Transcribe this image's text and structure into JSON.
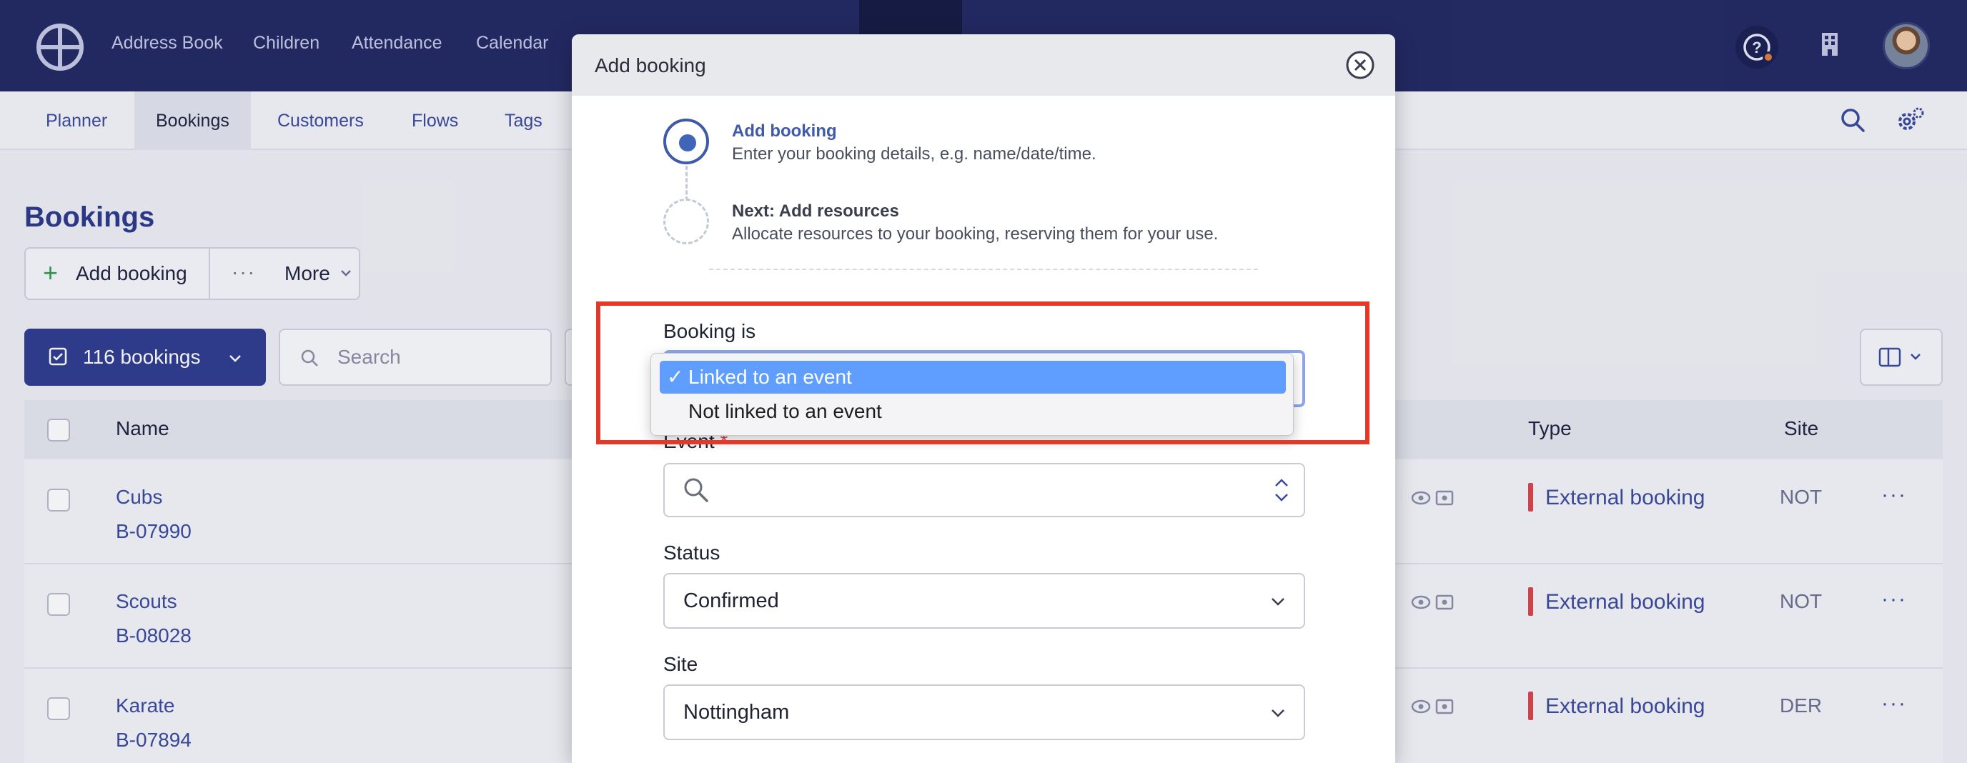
{
  "topnav": {
    "items": [
      "Address Book",
      "Children",
      "Attendance",
      "Calendar"
    ]
  },
  "subnav": {
    "tabs": [
      "Planner",
      "Bookings",
      "Customers",
      "Flows",
      "Tags"
    ],
    "active": "Bookings"
  },
  "page": {
    "title": "Bookings",
    "add_button": "Add booking",
    "more_button": "More",
    "bookings_count": "116 bookings",
    "search_placeholder": "Search"
  },
  "table": {
    "headers": {
      "name": "Name",
      "type": "Type",
      "site": "Site"
    },
    "rows": [
      {
        "name": "Cubs",
        "id": "B-07990",
        "type": "External booking",
        "site": "NOT"
      },
      {
        "name": "Scouts",
        "id": "B-08028",
        "type": "External booking",
        "site": "NOT"
      },
      {
        "name": "Karate",
        "id": "B-07894",
        "type": "External booking",
        "site": "DER"
      }
    ]
  },
  "modal": {
    "title": "Add booking",
    "step1_title": "Add booking",
    "step1_desc": "Enter your booking details, e.g. name/date/time.",
    "step2_title": "Next: Add resources",
    "step2_desc": "Allocate resources to your booking, reserving them for your use.",
    "booking_is_label": "Booking is",
    "event_label": "Event",
    "event_required": "*",
    "status_label": "Status",
    "status_value": "Confirmed",
    "site_label": "Site",
    "site_value": "Nottingham"
  },
  "dropdown": {
    "options": [
      "Linked to an event",
      "Not linked to an event"
    ],
    "selected": "Linked to an event",
    "check": "✓"
  },
  "colors": {
    "nav_bg": "#232a63",
    "accent": "#2f3d8f",
    "highlight": "#e23a2a",
    "selected_option": "#5f9dff"
  }
}
